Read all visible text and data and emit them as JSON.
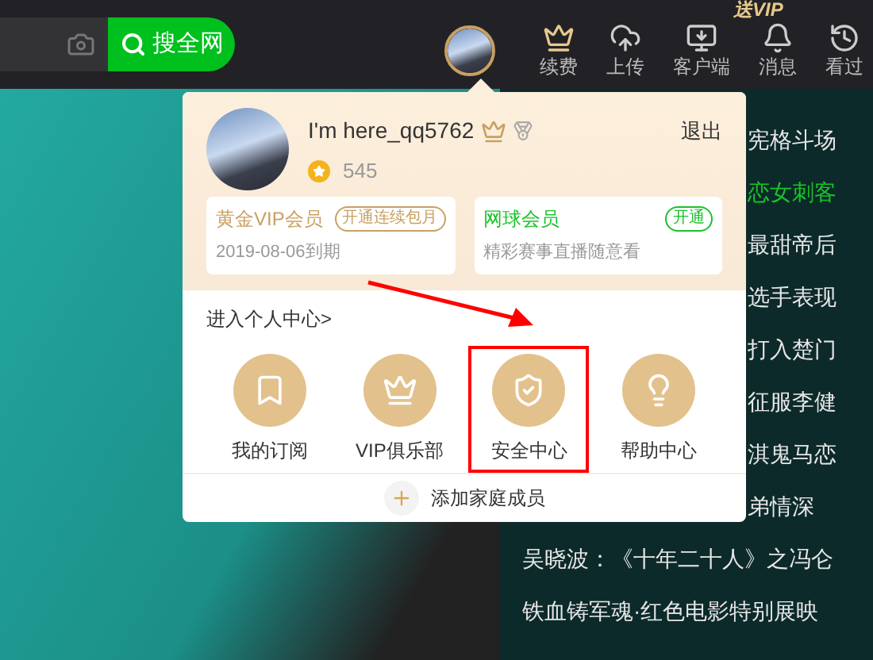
{
  "top_bar": {
    "search_button": "搜全网",
    "promo_badge": "送VIP",
    "nav_items": [
      {
        "kind": "renew",
        "label": "续费"
      },
      {
        "kind": "upload",
        "label": "上传"
      },
      {
        "kind": "client",
        "label": "客户端"
      },
      {
        "kind": "messages",
        "label": "消息"
      },
      {
        "kind": "history",
        "label": "看过"
      }
    ]
  },
  "side_list": [
    {
      "text": "宪格斗场",
      "color": "#e6e6e6"
    },
    {
      "text": "恋女刺客",
      "color": "#19c22a"
    },
    {
      "text": "最甜帝后",
      "color": "#e6e6e6"
    },
    {
      "text": "选手表现",
      "color": "#e6e6e6"
    },
    {
      "text": "打入楚门",
      "color": "#e6e6e6"
    },
    {
      "text": "征服李健",
      "color": "#e6e6e6"
    },
    {
      "text": "淇鬼马恋",
      "color": "#e6e6e6"
    },
    {
      "text": "弟情深",
      "color": "#e6e6e6"
    },
    {
      "text": "吴晓波：《十年二十人》之冯仑",
      "color": "#e6e6e6"
    },
    {
      "text": "铁血铸军魂·红色电影特别展映",
      "color": "#e6e6e6"
    }
  ],
  "user_menu": {
    "user_name": "I'm here_qq5762",
    "points": "545",
    "logout": "退出",
    "memberships": [
      {
        "title": "黄金VIP会员",
        "color": "#c9a063",
        "action": "开通连续包月",
        "note": "2019-08-06到期"
      },
      {
        "title": "网球会员",
        "color": "#19c22a",
        "action": "开通",
        "note": "精彩赛事直播随意看"
      }
    ],
    "center_link": "进入个人中心>",
    "shortcuts": [
      {
        "kind": "subscription",
        "label": "我的订阅",
        "highlighted": false
      },
      {
        "kind": "vip",
        "label": "VIP俱乐部",
        "highlighted": false
      },
      {
        "kind": "security",
        "label": "安全中心",
        "highlighted": true
      },
      {
        "kind": "help",
        "label": "帮助中心",
        "highlighted": false
      }
    ],
    "family_button": "添加家庭成员"
  }
}
